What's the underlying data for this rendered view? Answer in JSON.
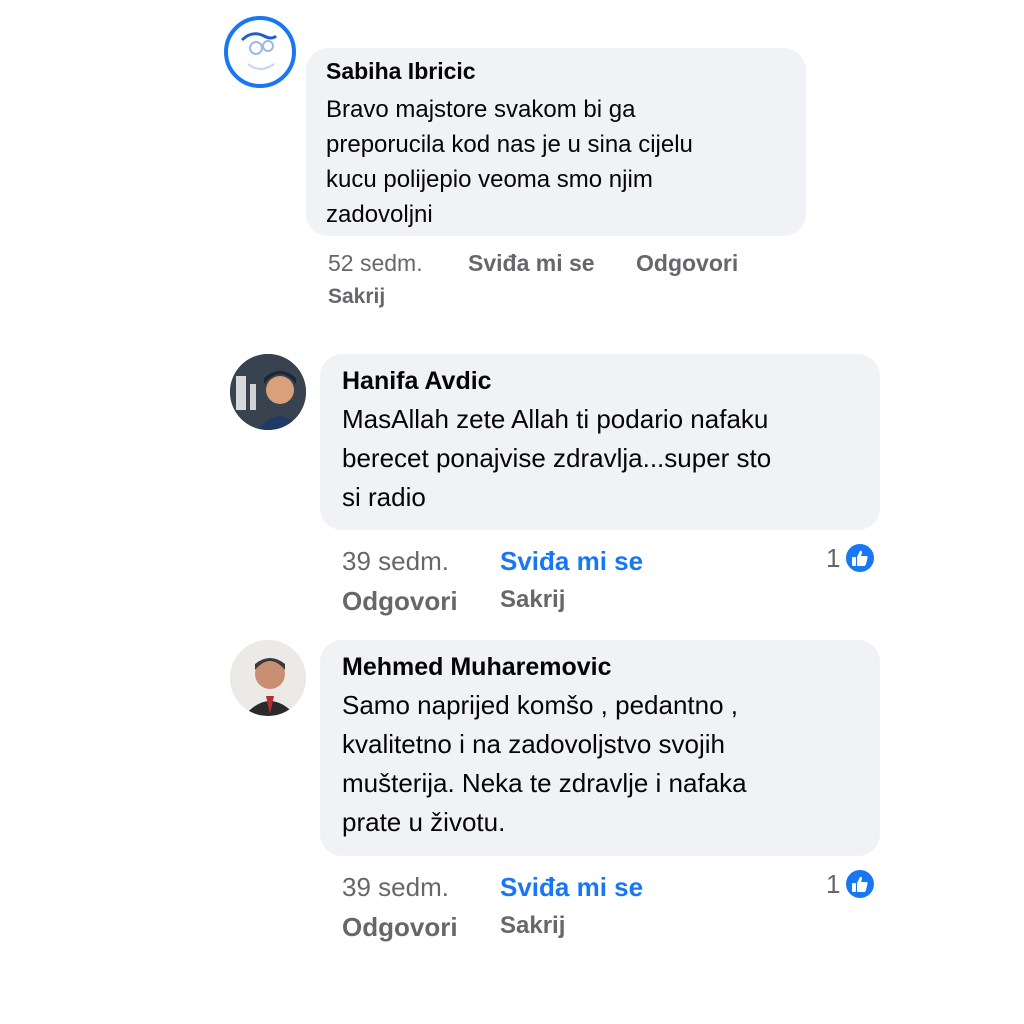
{
  "comments": [
    {
      "author": "Sabiha Ibricic",
      "text": "Bravo majstore svakom bi ga\npreporucila kod nas je u sina cijelu\nkucu polijepio veoma smo njim\nzadovoljni",
      "time": "52 sedm.",
      "like_label": "Sviđa mi se",
      "reply_label": "Odgovori",
      "hide_label": "Sakrij",
      "reaction_count": ""
    },
    {
      "author": "Hanifa Avdic",
      "text": "MasAllah zete Allah ti podario nafaku\nberecet ponajvise zdravlja...super sto\nsi radio",
      "time": "39 sedm.",
      "like_label": "Sviđa mi se",
      "reply_label": "Odgovori",
      "hide_label": "Sakrij",
      "reaction_count": "1"
    },
    {
      "author": "Mehmed Muharemovic",
      "text": "Samo naprijed komšo , pedantno ,\nkvalitetno i na zadovoljstvo svojih\nmušterija. Neka te zdravlje i nafaka\nprate u životu.",
      "time": "39 sedm.",
      "like_label": "Sviđa mi se",
      "reply_label": "Odgovori",
      "hide_label": "Sakrij",
      "reaction_count": "1"
    }
  ],
  "colors": {
    "accent": "#1877f2",
    "bubble": "#f0f2f5",
    "meta": "#65676b"
  }
}
